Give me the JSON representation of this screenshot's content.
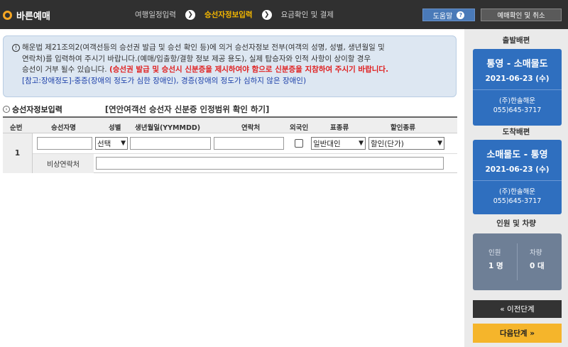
{
  "header": {
    "brand": "바른예매",
    "steps": [
      {
        "label": "여행일정입력",
        "active": false
      },
      {
        "label": "승선자정보입력",
        "active": true
      },
      {
        "label": "요금확인 및 결제",
        "active": false
      }
    ],
    "help_label": "도움말",
    "reservation_label": "예매확인 및 취소"
  },
  "notice": {
    "icon": "①",
    "line1": "해운법 제21조의2(여객선등의 승선권 발급 및 승선 확인 등)에 의거 승선자정보 전부(여객의 성명, 성별, 생년월일 및",
    "line2": "연락처)를 입력하여 주시기 바랍니다.(예매/입출항/결항 정보 제공 용도), 실제 탑승자와 인적 사항이 상이할 경우",
    "line3_plain": "승선이 거부 될수 있습니다. ",
    "line3_red": "(승선권 발급 및 승선시 신분증을 제시하여야 함으로 신분증을 지참하여 주시기 바랍니다.",
    "line4": "[참고:장애정도]-중증(장애의 정도가 심한 장애인), 경증(장애의 정도가 심하지 않은 장애인)"
  },
  "section": {
    "title": "승선자정보입력",
    "link": "[연안여객선 승선자 신분증 인정범위 확인 하기]"
  },
  "table": {
    "headers": {
      "seq": "순번",
      "name": "승선자명",
      "gender": "성별",
      "birth": "생년월일(YYMMDD)",
      "contact": "연락처",
      "foreigner": "외국인",
      "ticket": "표종류",
      "discount": "할인종류"
    },
    "rows": [
      {
        "seq": "1",
        "gender": "선택",
        "ticket": "일반대인",
        "discount": "할인(단가)",
        "emergency_label": "비상연락처"
      }
    ]
  },
  "sidebar": {
    "departure_title": "출발배편",
    "departure": {
      "route": "통영 - 소매물도",
      "date": "2021-06-23 (수)",
      "company": "(주)한솔해운",
      "phone": "055)645-3717"
    },
    "arrival_title": "도착배편",
    "arrival": {
      "route": "소매물도 - 통영",
      "date": "2021-06-23 (수)",
      "company": "(주)한솔해운",
      "phone": "055)645-3717"
    },
    "count_title": "인원 및 차량",
    "people_label": "인원",
    "people_value": "1 명",
    "vehicle_label": "차량",
    "vehicle_value": "0 대",
    "prev_label": "«  이전단계",
    "next_label": "다음단계  »"
  }
}
